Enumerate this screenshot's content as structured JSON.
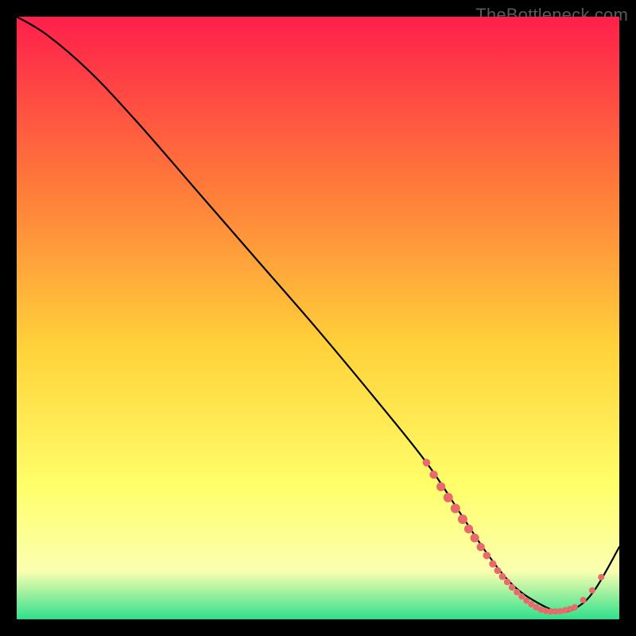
{
  "attribution": "TheBottleneck.com",
  "colors": {
    "gradient_top": "#ff1f4b",
    "gradient_mid_upper": "#ff7a3a",
    "gradient_mid": "#ffd23a",
    "gradient_mid_lower": "#ffff6a",
    "gradient_lower": "#fbffb0",
    "gradient_bottom": "#2fe08c",
    "curve": "#000000",
    "markers": "#e86a6a",
    "frame": "#000000"
  },
  "chart_data": {
    "type": "line",
    "title": "",
    "xlabel": "",
    "ylabel": "",
    "xlim": [
      0,
      100
    ],
    "ylim": [
      0,
      100
    ],
    "series": [
      {
        "name": "bottleneck-curve",
        "x": [
          0,
          5,
          12,
          20,
          30,
          40,
          50,
          60,
          68,
          74,
          78,
          82,
          86,
          90,
          93,
          96,
          100
        ],
        "values": [
          100,
          97,
          91,
          82.5,
          71,
          59.5,
          48,
          36,
          26,
          17,
          11,
          6,
          3,
          1.3,
          2,
          5,
          12
        ]
      }
    ],
    "markers": {
      "name": "highlight-cluster",
      "points": [
        {
          "x": 68.0,
          "y": 26.0,
          "r": 2.4
        },
        {
          "x": 69.2,
          "y": 24.0,
          "r": 2.6
        },
        {
          "x": 70.4,
          "y": 22.0,
          "r": 2.8
        },
        {
          "x": 71.6,
          "y": 20.2,
          "r": 3.0
        },
        {
          "x": 72.8,
          "y": 18.4,
          "r": 3.0
        },
        {
          "x": 74.0,
          "y": 16.6,
          "r": 3.0
        },
        {
          "x": 75.0,
          "y": 15.0,
          "r": 2.8
        },
        {
          "x": 76.0,
          "y": 13.5,
          "r": 2.8
        },
        {
          "x": 77.0,
          "y": 12.0,
          "r": 2.6
        },
        {
          "x": 78.0,
          "y": 10.6,
          "r": 2.4
        },
        {
          "x": 79.0,
          "y": 9.2,
          "r": 2.3
        },
        {
          "x": 79.8,
          "y": 8.1,
          "r": 2.2
        },
        {
          "x": 80.6,
          "y": 7.1,
          "r": 2.2
        },
        {
          "x": 81.4,
          "y": 6.2,
          "r": 2.1
        },
        {
          "x": 82.2,
          "y": 5.3,
          "r": 2.1
        },
        {
          "x": 83.0,
          "y": 4.5,
          "r": 2.0
        },
        {
          "x": 83.8,
          "y": 3.8,
          "r": 2.0
        },
        {
          "x": 84.6,
          "y": 3.1,
          "r": 2.0
        },
        {
          "x": 85.4,
          "y": 2.5,
          "r": 2.0
        },
        {
          "x": 86.2,
          "y": 2.0,
          "r": 2.0
        },
        {
          "x": 87.0,
          "y": 1.6,
          "r": 2.0
        },
        {
          "x": 87.8,
          "y": 1.4,
          "r": 2.0
        },
        {
          "x": 88.6,
          "y": 1.3,
          "r": 2.0
        },
        {
          "x": 89.4,
          "y": 1.3,
          "r": 2.0
        },
        {
          "x": 90.2,
          "y": 1.35,
          "r": 2.0
        },
        {
          "x": 91.0,
          "y": 1.5,
          "r": 2.0
        },
        {
          "x": 91.8,
          "y": 1.7,
          "r": 2.0
        },
        {
          "x": 92.6,
          "y": 2.0,
          "r": 2.0
        },
        {
          "x": 94.0,
          "y": 3.2,
          "r": 2.0
        },
        {
          "x": 95.5,
          "y": 4.8,
          "r": 2.0
        },
        {
          "x": 97.0,
          "y": 7.0,
          "r": 2.0
        }
      ]
    }
  }
}
